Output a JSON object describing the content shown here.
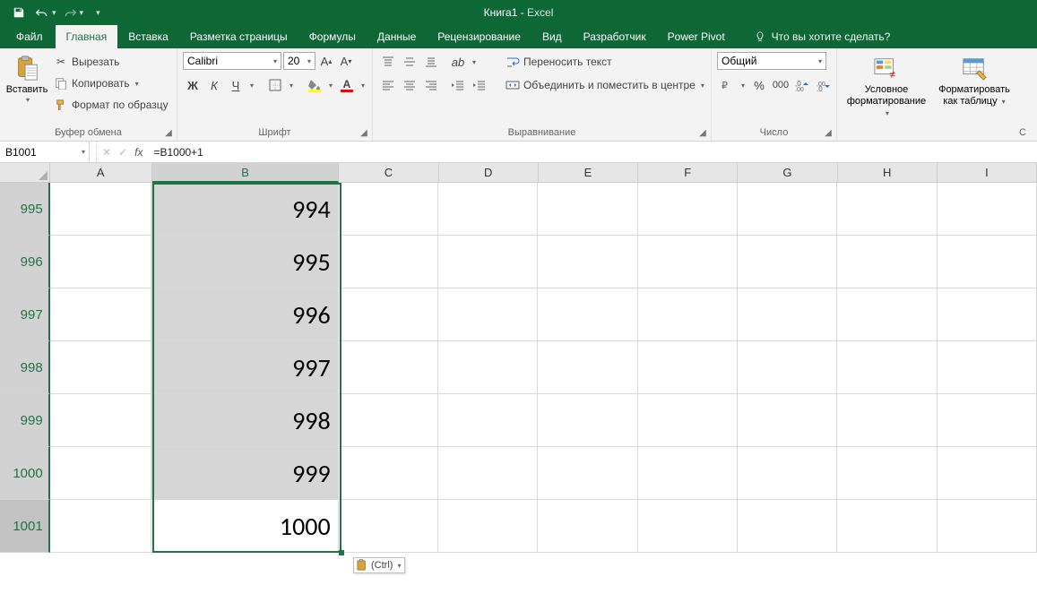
{
  "title": {
    "doc": "Книга1",
    "sep": "  -  ",
    "app": "Excel"
  },
  "tabs": {
    "file": "Файл",
    "items": [
      "Главная",
      "Вставка",
      "Разметка страницы",
      "Формулы",
      "Данные",
      "Рецензирование",
      "Вид",
      "Разработчик",
      "Power Pivot"
    ],
    "active_index": 0,
    "tell_me": "Что вы хотите сделать?"
  },
  "ribbon": {
    "clipboard": {
      "paste": "Вставить",
      "cut": "Вырезать",
      "copy": "Копировать",
      "format_painter": "Формат по образцу",
      "group_label": "Буфер обмена"
    },
    "font": {
      "name": "Calibri",
      "size": "20",
      "bold": "Ж",
      "italic": "К",
      "underline": "Ч",
      "group_label": "Шрифт"
    },
    "alignment": {
      "wrap": "Переносить текст",
      "merge": "Объединить и поместить в центре",
      "group_label": "Выравнивание"
    },
    "number": {
      "format": "Общий",
      "group_label": "Число"
    },
    "styles": {
      "cond_fmt_l1": "Условное",
      "cond_fmt_l2": "форматирование",
      "as_table_l1": "Форматировать",
      "as_table_l2": "как таблицу"
    }
  },
  "namebox": "B1001",
  "formula": "=B1000+1",
  "columns": [
    "A",
    "B",
    "C",
    "D",
    "E",
    "F",
    "G",
    "H",
    "I"
  ],
  "selected_col_index": 1,
  "rows": [
    {
      "num": "995",
      "b": "994"
    },
    {
      "num": "996",
      "b": "995"
    },
    {
      "num": "997",
      "b": "996"
    },
    {
      "num": "998",
      "b": "997"
    },
    {
      "num": "999",
      "b": "998"
    },
    {
      "num": "1000",
      "b": "999"
    },
    {
      "num": "1001",
      "b": "1000"
    }
  ],
  "active_row_index": 6,
  "paste_tag": "(Ctrl)"
}
